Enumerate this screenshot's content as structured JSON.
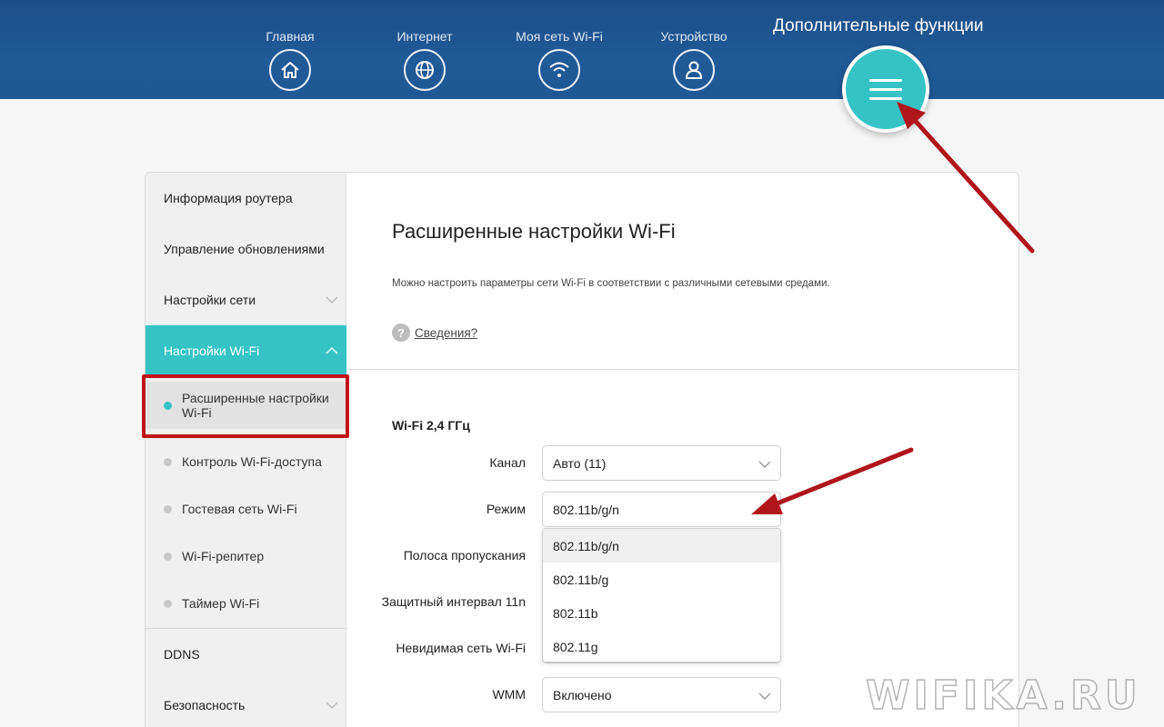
{
  "nav": {
    "items": [
      {
        "label": "Главная",
        "icon": "home-icon"
      },
      {
        "label": "Интернет",
        "icon": "globe-icon"
      },
      {
        "label": "Моя сеть Wi-Fi",
        "icon": "wifi-icon"
      },
      {
        "label": "Устройство",
        "icon": "user-icon"
      }
    ],
    "advanced_label": "Дополнительные функции",
    "menu_icon": "hamburger-menu-icon"
  },
  "sidebar": {
    "items": [
      {
        "label": "Информация роутера"
      },
      {
        "label": "Управление обновлениями"
      },
      {
        "label": "Настройки сети"
      },
      {
        "label": "Настройки Wi-Fi"
      }
    ],
    "wifi_sub": [
      {
        "label": "Расширенные настройки Wi-Fi"
      },
      {
        "label": "Контроль Wi-Fi-доступа"
      },
      {
        "label": "Гостевая сеть Wi-Fi"
      },
      {
        "label": "Wi-Fi-репитер"
      },
      {
        "label": "Таймер Wi-Fi"
      }
    ],
    "bottom": [
      {
        "label": "DDNS"
      },
      {
        "label": "Безопасность"
      }
    ]
  },
  "main": {
    "title": "Расширенные настройки Wi-Fi",
    "description": "Можно настроить параметры сети Wi-Fi в соответствии с различными сетевыми средами.",
    "help_link": "Сведения?",
    "section_title": "Wi-Fi 2,4 ГГц",
    "fields": {
      "channel": {
        "label": "Канал",
        "value": "Авто (11)"
      },
      "mode": {
        "label": "Режим",
        "value": "802.11b/g/n"
      },
      "bandwidth": {
        "label": "Полоса пропускания"
      },
      "guard": {
        "label": "Защитный интервал 11n"
      },
      "hidden": {
        "label": "Невидимая сеть Wi-Fi"
      },
      "wmm": {
        "label": "WMM",
        "value": "Включено"
      }
    },
    "mode_options": [
      "802.11b/g/n",
      "802.11b/g",
      "802.11b",
      "802.11g"
    ]
  },
  "colors": {
    "header_blue": "#205a97",
    "accent_teal": "#35c3c6",
    "annotation_red": "#c1121c"
  },
  "watermark": "WIFIKA.RU"
}
